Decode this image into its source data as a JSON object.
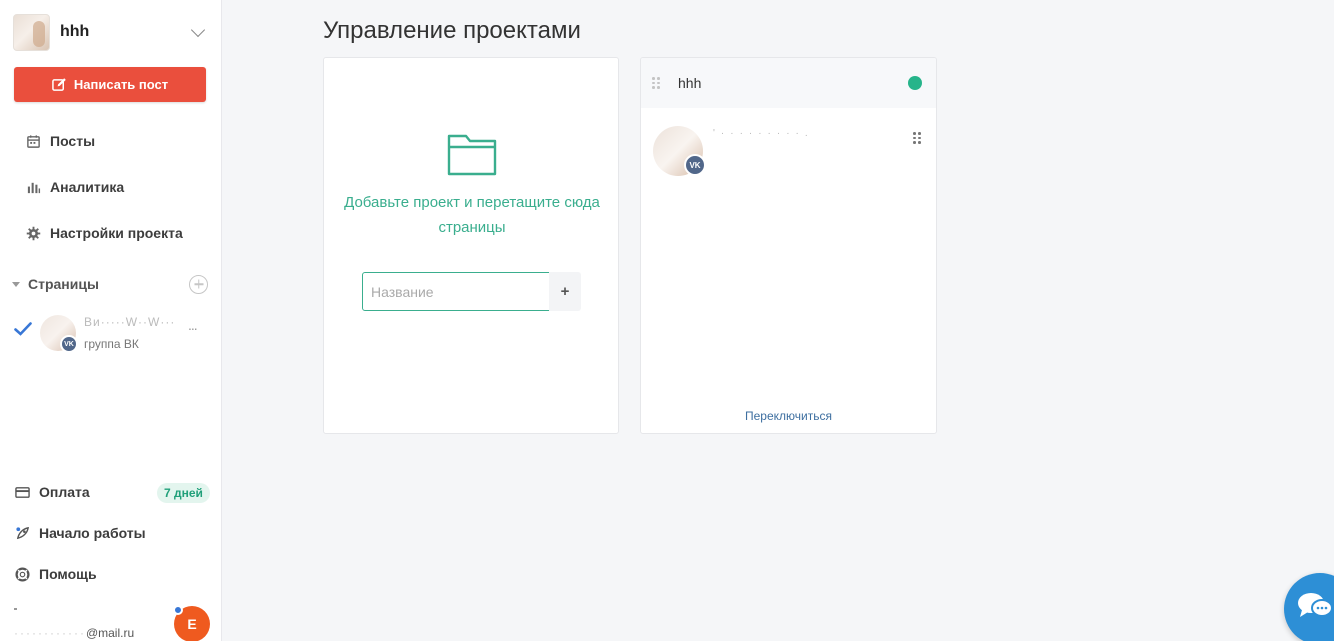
{
  "sidebar": {
    "project_name": "hhh",
    "write_post_label": "Написать пост",
    "nav": {
      "posts": "Посты",
      "analytics": "Аналитика",
      "settings": "Настройки проекта"
    },
    "pages": {
      "label": "Страницы",
      "items": [
        {
          "title": "Ви·····W··W···",
          "dots": "...",
          "subtitle": "группа ВК",
          "badge": "vk",
          "selected": true
        }
      ]
    },
    "bottom": {
      "billing": "Оплата",
      "billing_badge": "7 дней",
      "getting_started": "Начало работы",
      "help": "Помощь"
    },
    "user": {
      "email_masked": "············",
      "email_domain": "@mail.ru",
      "avatar_letter": "E"
    }
  },
  "main": {
    "title": "Управление проектами",
    "new_project_card": {
      "hint": "Добавьте проект и перетащите сюда страницы",
      "input_placeholder": "Название",
      "add_label": "+"
    },
    "project_card": {
      "name": "hhh",
      "status": "active",
      "page_name_masked": "'·········.",
      "page_badge": "vk",
      "switch_label": "Переключиться"
    }
  },
  "colors": {
    "accent_red": "#ea4f3d",
    "accent_green": "#3aae8e",
    "status_green": "#26b48a",
    "vk_blue": "#51678a",
    "link_blue": "#3e6fa0",
    "chat_blue": "#2d8fd6",
    "user_orange": "#ef5a1f"
  }
}
